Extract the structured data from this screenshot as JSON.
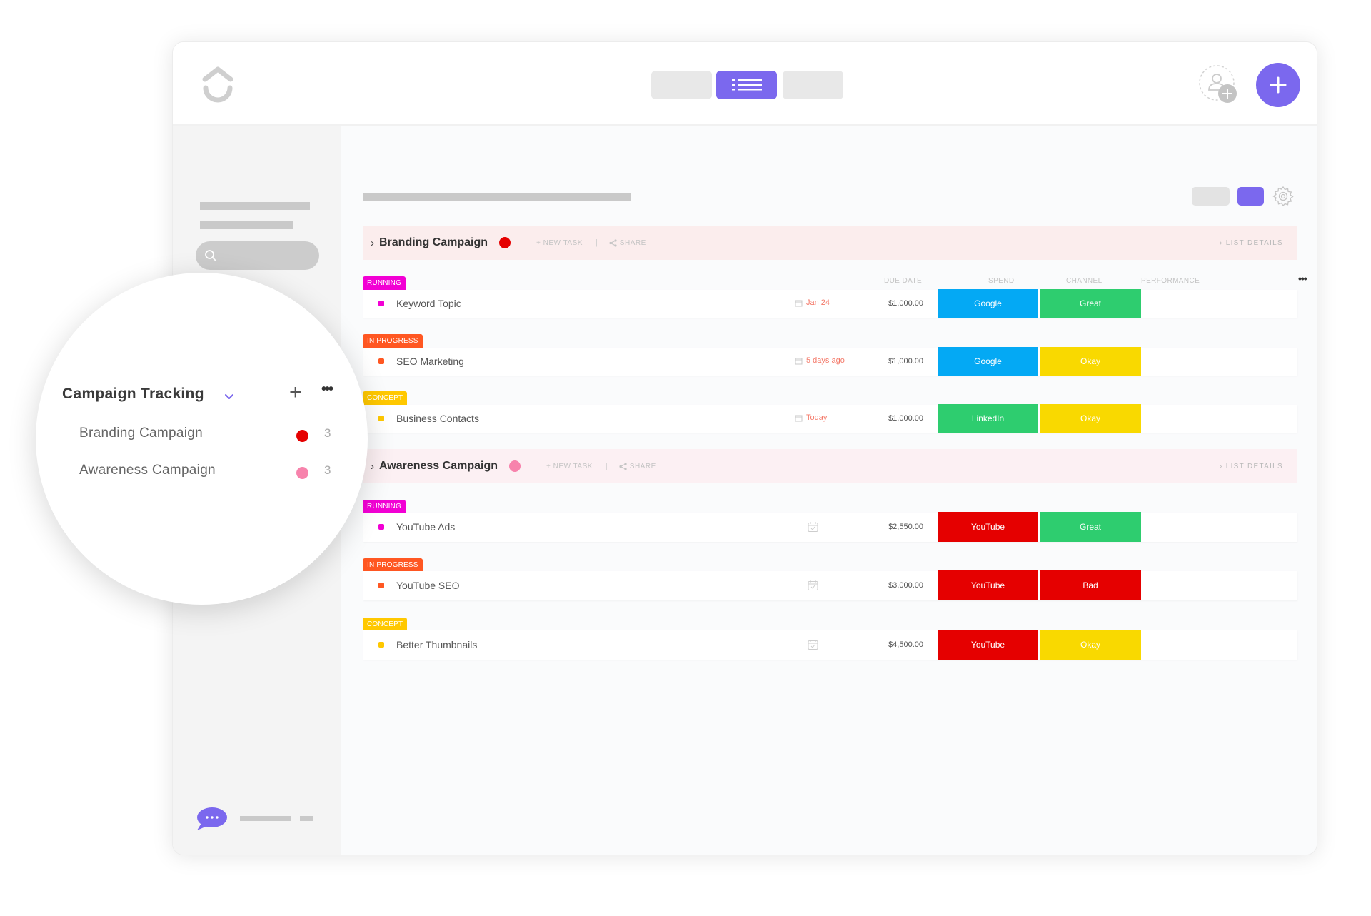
{
  "header": {
    "logo": "clickup-logo-icon",
    "view_buttons": [
      {
        "name": "view-board",
        "active": false
      },
      {
        "name": "view-list",
        "active": true,
        "icon": "list-icon"
      },
      {
        "name": "view-calendar",
        "active": false
      }
    ],
    "invite_icon": "add-user-icon",
    "create_icon": "plus-icon"
  },
  "sidebar": {
    "search_icon": "search-icon",
    "chat_icon": "chat-bubble-icon"
  },
  "toolbar": {
    "settings_icon": "gear-icon"
  },
  "columns": {
    "due_date": "DUE DATE",
    "spend": "SPEND",
    "channel": "CHANNEL",
    "performance": "PERFORMANCE",
    "more": "•••"
  },
  "groups": [
    {
      "name": "Branding Campaign",
      "chevron": "›",
      "color": "#e50000",
      "new_task": "+ NEW TASK",
      "separator": "|",
      "share": "SHARE",
      "list_details": "› LIST DETAILS",
      "tasks": [
        {
          "status": "RUNNING",
          "status_color": "#f200d4",
          "name": "Keyword Topic",
          "due": "Jan 24",
          "spend": "$1,000.00",
          "channel": "Google",
          "channel_color": "#04a9f4",
          "performance": "Great",
          "performance_color": "#2ecd6f"
        },
        {
          "status": "IN PROGRESS",
          "status_color": "#ff5722",
          "name": "SEO Marketing",
          "due": "5 days ago",
          "spend": "$1,000.00",
          "channel": "Google",
          "channel_color": "#04a9f4",
          "performance": "Okay",
          "performance_color": "#f9d900"
        },
        {
          "status": "CONCEPT",
          "status_color": "#ffc800",
          "name": "Business Contacts",
          "due": "Today",
          "spend": "$1,000.00",
          "channel": "LinkedIn",
          "channel_color": "#2ecd6f",
          "performance": "Okay",
          "performance_color": "#f9d900"
        }
      ]
    },
    {
      "name": "Awareness Campaign",
      "chevron": "›",
      "color": "#f783ac",
      "new_task": "+ NEW TASK",
      "separator": "|",
      "share": "SHARE",
      "list_details": "› LIST DETAILS",
      "tasks": [
        {
          "status": "RUNNING",
          "status_color": "#f200d4",
          "name": "YouTube Ads",
          "due": "",
          "spend": "$2,550.00",
          "channel": "YouTube",
          "channel_color": "#e50000",
          "performance": "Great",
          "performance_color": "#2ecd6f"
        },
        {
          "status": "IN PROGRESS",
          "status_color": "#ff5722",
          "name": "YouTube SEO",
          "due": "",
          "spend": "$3,000.00",
          "channel": "YouTube",
          "channel_color": "#e50000",
          "performance": "Bad",
          "performance_color": "#e50000"
        },
        {
          "status": "CONCEPT",
          "status_color": "#ffc800",
          "name": "Better Thumbnails",
          "due": "",
          "spend": "$4,500.00",
          "channel": "YouTube",
          "channel_color": "#e50000",
          "performance": "Okay",
          "performance_color": "#f9d900"
        }
      ]
    }
  ],
  "magnifier": {
    "title": "Campaign Tracking",
    "plus": "+",
    "more": "•••",
    "lists": [
      {
        "name": "Branding Campaign",
        "color": "#e50000",
        "count": "3"
      },
      {
        "name": "Awareness Campaign",
        "color": "#f783ac",
        "count": "3"
      }
    ]
  },
  "colors": {
    "accent": "#7b68ee",
    "due_overdue": "#f47a6a"
  }
}
